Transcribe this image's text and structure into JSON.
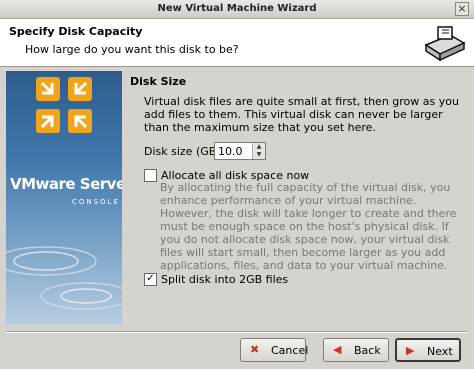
{
  "window": {
    "title": "New Virtual Machine Wizard"
  },
  "header": {
    "title": "Specify Disk Capacity",
    "subtitle": "How large do you want this disk to be?",
    "icon": "disk-drive-icon"
  },
  "banner": {
    "brand": "VMware Server",
    "tagline": "CONSOLE"
  },
  "disk_size": {
    "section_title": "Disk Size",
    "description": "Virtual disk files are quite small at first, then grow as you add files to them. This virtual disk can never be larger than the maximum size that you set here.",
    "size_label": "Disk size (GB):",
    "size_value": "10.0",
    "allocate_label": "Allocate all disk space now",
    "allocate_checked": false,
    "allocate_description": "By allocating the full capacity of the virtual disk, you enhance performance of your virtual machine. However, the disk will take longer to create and there must be enough space on the host's physical disk. If you do not allocate disk space now, your virtual disk files will start small, then become larger as you add applications, files, and data to your virtual machine.",
    "split_label": "Split disk into 2GB files",
    "split_checked": true
  },
  "buttons": {
    "cancel": "Cancel",
    "back": "Back",
    "next": "Next"
  },
  "colors": {
    "cancel_icon": "#c0392b",
    "back_icon": "#c0392b"
  }
}
